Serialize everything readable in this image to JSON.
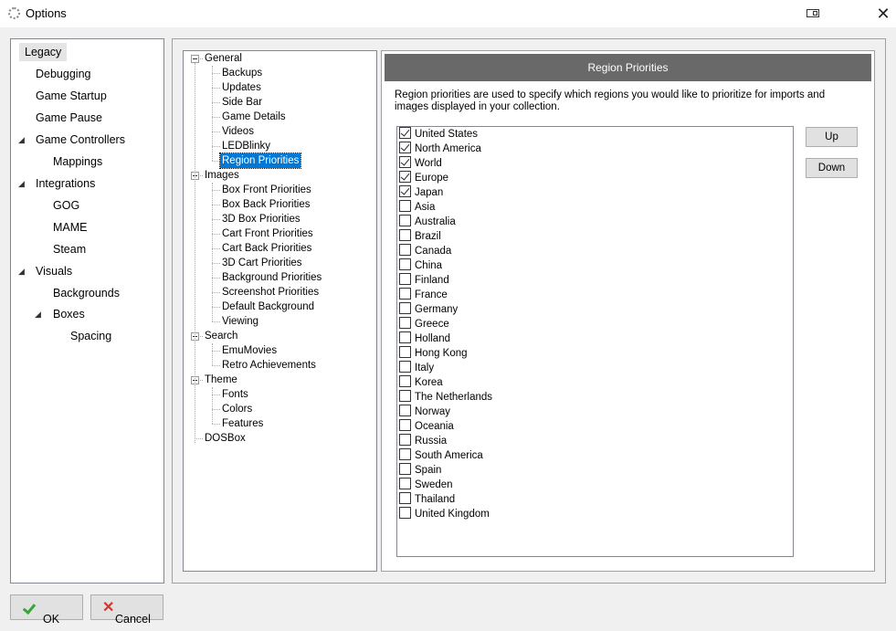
{
  "window": {
    "title": "Options",
    "app_icon": "gear-icon",
    "restore_icon": "restore-window-icon",
    "close_glyph": "✕"
  },
  "left_nav": {
    "items": [
      {
        "label": "Legacy",
        "selected": true
      },
      {
        "label": "Debugging"
      },
      {
        "label": "Game Startup"
      },
      {
        "label": "Game Pause"
      },
      {
        "label": "Game Controllers",
        "expanded": true
      },
      {
        "label": "Mappings"
      },
      {
        "label": "Integrations",
        "expanded": true
      },
      {
        "label": "GOG"
      },
      {
        "label": "MAME"
      },
      {
        "label": "Steam"
      },
      {
        "label": "Visuals",
        "expanded": true
      },
      {
        "label": "Backgrounds"
      },
      {
        "label": "Boxes",
        "expanded": true
      },
      {
        "label": "Spacing"
      }
    ]
  },
  "tree": {
    "items": [
      {
        "label": "General"
      },
      {
        "label": "Backups"
      },
      {
        "label": "Updates"
      },
      {
        "label": "Side Bar"
      },
      {
        "label": "Game Details"
      },
      {
        "label": "Videos"
      },
      {
        "label": "LEDBlinky"
      },
      {
        "label": "Region Priorities",
        "selected": true
      },
      {
        "label": "Images"
      },
      {
        "label": "Box Front Priorities"
      },
      {
        "label": "Box Back Priorities"
      },
      {
        "label": "3D Box Priorities"
      },
      {
        "label": "Cart Front Priorities"
      },
      {
        "label": "Cart Back Priorities"
      },
      {
        "label": "3D Cart Priorities"
      },
      {
        "label": "Background Priorities"
      },
      {
        "label": "Screenshot Priorities"
      },
      {
        "label": "Default Background"
      },
      {
        "label": "Viewing"
      },
      {
        "label": "Search"
      },
      {
        "label": "EmuMovies"
      },
      {
        "label": "Retro Achievements"
      },
      {
        "label": "Theme"
      },
      {
        "label": "Fonts"
      },
      {
        "label": "Colors"
      },
      {
        "label": "Features"
      },
      {
        "label": "DOSBox"
      }
    ]
  },
  "region_panel": {
    "header": "Region Priorities",
    "description": "Region priorities are used to specify which regions you would like to prioritize for imports and images displayed in your collection.",
    "regions": [
      {
        "label": "United States",
        "checked": true
      },
      {
        "label": "North America",
        "checked": true
      },
      {
        "label": "World",
        "checked": true
      },
      {
        "label": "Europe",
        "checked": true
      },
      {
        "label": "Japan",
        "checked": true
      },
      {
        "label": "Asia",
        "checked": false
      },
      {
        "label": "Australia",
        "checked": false
      },
      {
        "label": "Brazil",
        "checked": false
      },
      {
        "label": "Canada",
        "checked": false
      },
      {
        "label": "China",
        "checked": false
      },
      {
        "label": "Finland",
        "checked": false
      },
      {
        "label": "France",
        "checked": false
      },
      {
        "label": "Germany",
        "checked": false
      },
      {
        "label": "Greece",
        "checked": false
      },
      {
        "label": "Holland",
        "checked": false
      },
      {
        "label": "Hong Kong",
        "checked": false
      },
      {
        "label": "Italy",
        "checked": false
      },
      {
        "label": "Korea",
        "checked": false
      },
      {
        "label": "The Netherlands",
        "checked": false
      },
      {
        "label": "Norway",
        "checked": false
      },
      {
        "label": "Oceania",
        "checked": false
      },
      {
        "label": "Russia",
        "checked": false
      },
      {
        "label": "South America",
        "checked": false
      },
      {
        "label": "Spain",
        "checked": false
      },
      {
        "label": "Sweden",
        "checked": false
      },
      {
        "label": "Thailand",
        "checked": false
      },
      {
        "label": "United Kingdom",
        "checked": false
      }
    ],
    "up_label": "Up",
    "down_label": "Down"
  },
  "footer": {
    "ok_label": "OK",
    "ok_icon": "check-icon",
    "cancel_label": "Cancel",
    "cancel_icon": "x-icon",
    "accent_ok": "#3aa33a",
    "accent_cancel": "#d9342b"
  },
  "colors": {
    "selection": "#0078d7",
    "header_bg": "#696969"
  }
}
